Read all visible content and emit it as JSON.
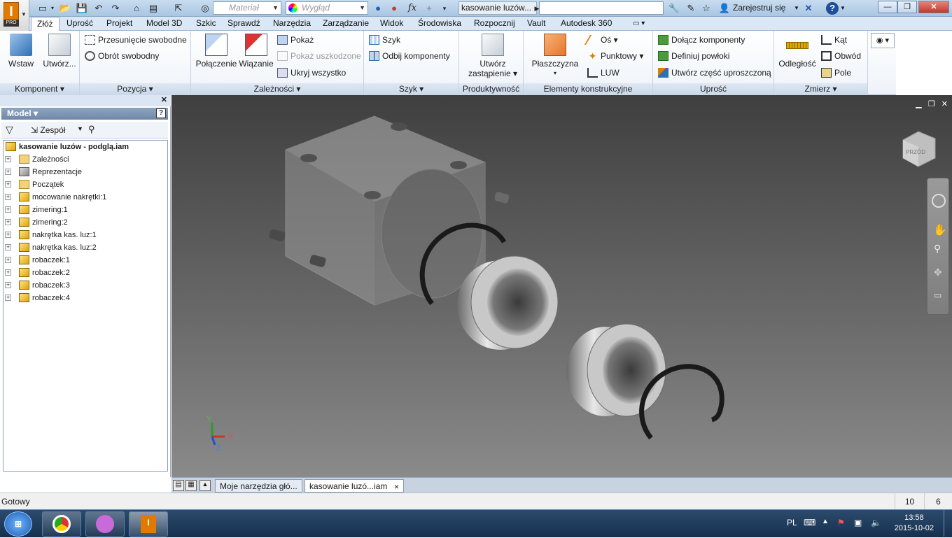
{
  "window": {
    "document_title": "kasowanie luzów...",
    "material_placeholder": "Materiał",
    "appearance_placeholder": "Wygląd",
    "sign_in": "Zarejestruj się",
    "app_logo": "I",
    "app_badge": "PRO"
  },
  "menu_tabs": [
    "Złóż",
    "Uprość",
    "Projekt",
    "Model 3D",
    "Szkic",
    "Sprawdź",
    "Narzędzia",
    "Zarządzanie",
    "Widok",
    "Środowiska",
    "Rozpocznij",
    "Vault",
    "Autodesk 360"
  ],
  "ribbon": {
    "komponent": {
      "title": "Komponent",
      "insert": "Wstaw",
      "create": "Utwórz..."
    },
    "pozycja": {
      "title": "Pozycja",
      "free_move": "Przesunięcie swobodne",
      "free_rotate": "Obrót swobodny"
    },
    "zaleznosci": {
      "title": "Zależności",
      "joint": "Połączenie",
      "constrain": "Wiązanie",
      "show": "Pokaż",
      "show_sick": "Pokaż uszkodzone",
      "hide_all": "Ukryj wszystko"
    },
    "szyk": {
      "title": "Szyk",
      "pattern": "Szyk",
      "mirror": "Odbij komponenty"
    },
    "produktywnosc": {
      "title": "Produktywność",
      "create_sub_1": "Utwórz",
      "create_sub_2": "zastąpienie"
    },
    "elementy": {
      "title": "Elementy konstrukcyjne",
      "plane": "Płaszczyzna",
      "axis": "Oś",
      "point": "Punktowy",
      "ucs": "LUW"
    },
    "uprosc": {
      "title": "Uprość",
      "include": "Dołącz komponenty",
      "define_envelope": "Definiuj powłoki",
      "create_simplified": "Utwórz część uproszczoną"
    },
    "zmierz": {
      "title": "Zmierz",
      "distance": "Odległość",
      "angle": "Kąt",
      "loop": "Obwód",
      "area": "Pole"
    }
  },
  "model_panel": {
    "title": "Model",
    "filter_label": "Zespół",
    "tree": [
      {
        "label": "kasowanie luzów - podglą.iam",
        "type": "assembly",
        "root": true
      },
      {
        "label": "Zależności",
        "type": "folder"
      },
      {
        "label": "Reprezentacje",
        "type": "repr"
      },
      {
        "label": "Początek",
        "type": "folder"
      },
      {
        "label": "mocowanie nakrętki:1",
        "type": "part"
      },
      {
        "label": "zimering:1",
        "type": "part"
      },
      {
        "label": "zimering:2",
        "type": "part"
      },
      {
        "label": "nakrętka kas. luz:1",
        "type": "part"
      },
      {
        "label": "nakrętka kas. luz:2",
        "type": "part"
      },
      {
        "label": "robaczek:1",
        "type": "part"
      },
      {
        "label": "robaczek:2",
        "type": "part"
      },
      {
        "label": "robaczek:3",
        "type": "part"
      },
      {
        "label": "robaczek:4",
        "type": "part"
      }
    ]
  },
  "viewport": {
    "viewcube_label": "PRZÓD",
    "axis_x": "X",
    "axis_y": "Y",
    "axis_z": "Z"
  },
  "doc_tabs": [
    "Moje narzędzia głó...",
    "kasowanie luzó...iam"
  ],
  "status": {
    "text": "Gotowy",
    "count1": "10",
    "count2": "6"
  },
  "taskbar": {
    "language": "PL",
    "time": "13:58",
    "date": "2015-10-02"
  },
  "colors": {
    "accent": "#e07a00",
    "ribbon_bg": "#eef3f9",
    "viewport_top": "#3f3f3f",
    "viewport_bottom": "#8a8a8a"
  }
}
